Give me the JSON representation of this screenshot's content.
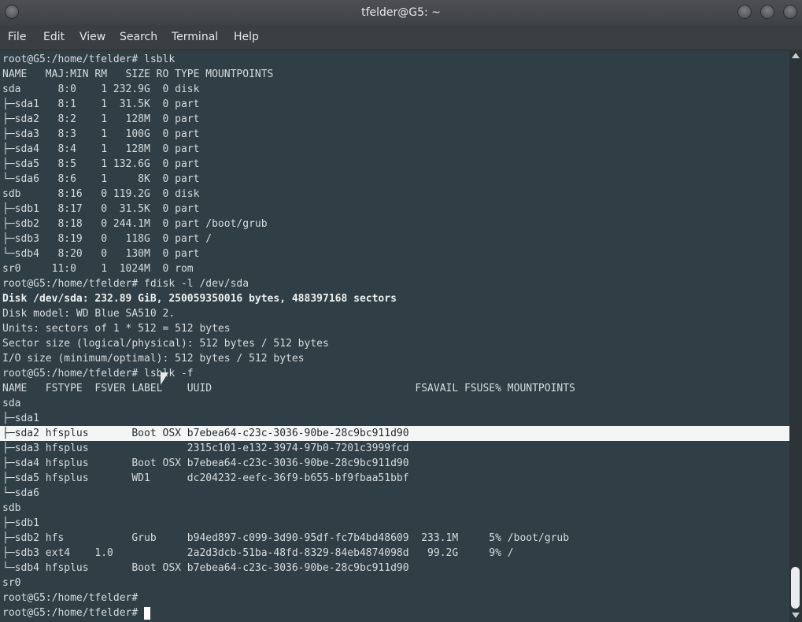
{
  "window": {
    "title": "tfelder@G5: ~"
  },
  "menu": [
    "File",
    "Edit",
    "View",
    "Search",
    "Terminal",
    "Help"
  ],
  "terminal": {
    "lines": [
      {
        "text": "root@G5:/home/tfelder# lsblk"
      },
      {
        "text": "NAME   MAJ:MIN RM   SIZE RO TYPE MOUNTPOINTS"
      },
      {
        "text": "sda      8:0    1 232.9G  0 disk"
      },
      {
        "text": "├─sda1   8:1    1  31.5K  0 part"
      },
      {
        "text": "├─sda2   8:2    1   128M  0 part"
      },
      {
        "text": "├─sda3   8:3    1   100G  0 part"
      },
      {
        "text": "├─sda4   8:4    1   128M  0 part"
      },
      {
        "text": "├─sda5   8:5    1 132.6G  0 part"
      },
      {
        "text": "└─sda6   8:6    1     8K  0 part"
      },
      {
        "text": "sdb      8:16   0 119.2G  0 disk"
      },
      {
        "text": "├─sdb1   8:17   0  31.5K  0 part"
      },
      {
        "text": "├─sdb2   8:18   0 244.1M  0 part /boot/grub"
      },
      {
        "text": "├─sdb3   8:19   0   118G  0 part /"
      },
      {
        "text": "└─sdb4   8:20   0   130M  0 part"
      },
      {
        "text": "sr0     11:0    1  1024M  0 rom"
      },
      {
        "text": "root@G5:/home/tfelder# fdisk -l /dev/sda"
      },
      {
        "text": "Disk /dev/sda: 232.89 GiB, 250059350016 bytes, 488397168 sectors",
        "bold": true
      },
      {
        "text": "Disk model: WD Blue SA510 2."
      },
      {
        "text": "Units: sectors of 1 * 512 = 512 bytes"
      },
      {
        "text": "Sector size (logical/physical): 512 bytes / 512 bytes"
      },
      {
        "text": "I/O size (minimum/optimal): 512 bytes / 512 bytes"
      },
      {
        "text": "root@G5:/home/tfelder# lsblk -f"
      },
      {
        "text": "NAME   FSTYPE  FSVER LABEL    UUID                                 FSAVAIL FSUSE% MOUNTPOINTS"
      },
      {
        "text": "sda"
      },
      {
        "text": "├─sda1"
      },
      {
        "text": "├─sda2 hfsplus       Boot OSX b7ebea64-c23c-3036-90be-28c9bc911d90",
        "highlight": true
      },
      {
        "text": "├─sda3 hfsplus                2315c101-e132-3974-97b0-7201c3999fcd"
      },
      {
        "text": "├─sda4 hfsplus       Boot OSX b7ebea64-c23c-3036-90be-28c9bc911d90"
      },
      {
        "text": "├─sda5 hfsplus       WD1      dc204232-eefc-36f9-b655-bf9fbaa51bbf"
      },
      {
        "text": "└─sda6"
      },
      {
        "text": "sdb"
      },
      {
        "text": "├─sdb1"
      },
      {
        "text": "├─sdb2 hfs           Grub     b94ed897-c099-3d90-95df-fc7b4bd48609  233.1M     5% /boot/grub"
      },
      {
        "text": "├─sdb3 ext4    1.0            2a2d3dcb-51ba-48fd-8329-84eb4874098d   99.2G     9% /"
      },
      {
        "text": "└─sdb4 hfsplus       Boot OSX b7ebea64-c23c-3036-90be-28c9bc911d90"
      },
      {
        "text": "sr0"
      },
      {
        "text": "root@G5:/home/tfelder#"
      },
      {
        "text": "root@G5:/home/tfelder# "
      }
    ]
  }
}
